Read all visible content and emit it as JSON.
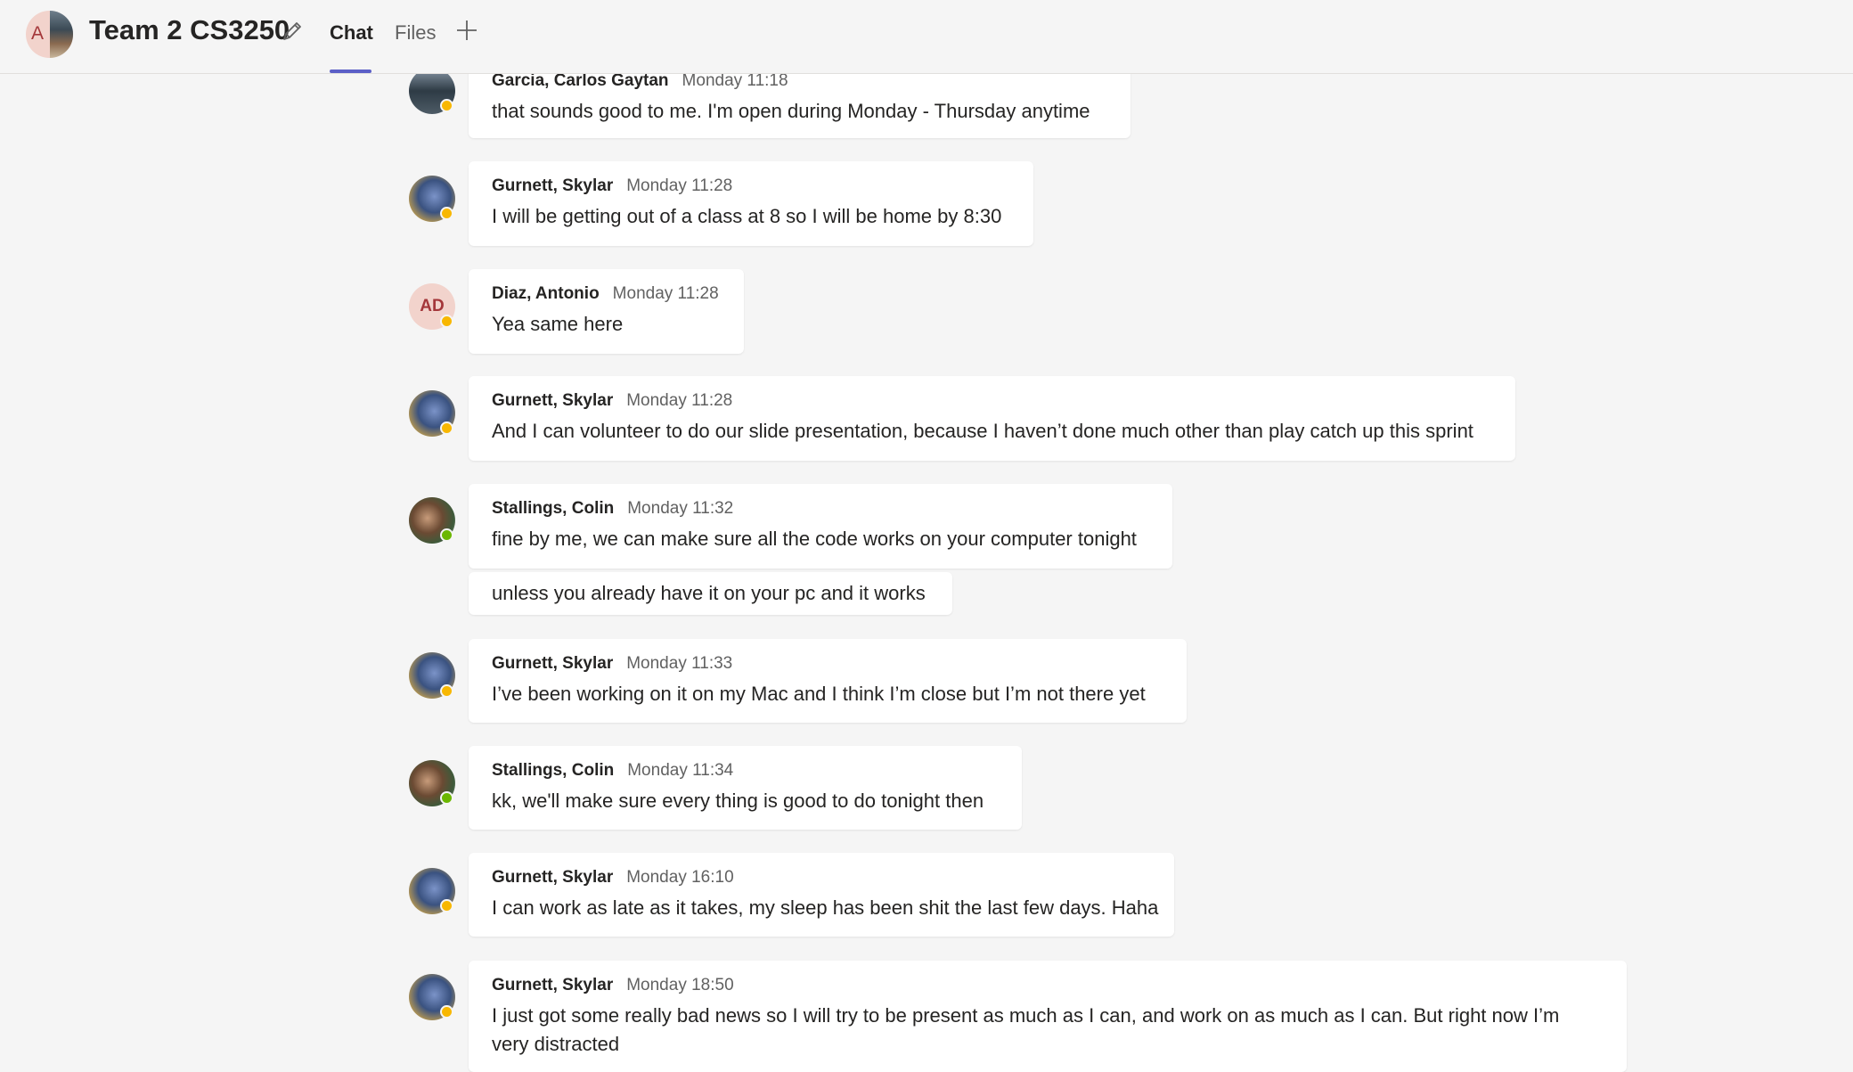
{
  "header": {
    "avatar_initial": "A",
    "title": "Team 2 CS3250",
    "tabs": [
      {
        "label": "Chat"
      },
      {
        "label": "Files"
      }
    ],
    "add_tab_label": "+"
  },
  "messages": [
    {
      "sender": "Garcia, Carlos Gaytan",
      "time": "Monday 11:18",
      "text": "that sounds good to me. I'm open during Monday - Thursday anytime",
      "presence": "away"
    },
    {
      "sender": "Gurnett, Skylar",
      "time": "Monday 11:28",
      "text": "I will be getting out of a class at 8 so I will be home by 8:30",
      "presence": "away"
    },
    {
      "sender": "Diaz, Antonio",
      "initials": "AD",
      "time": "Monday 11:28",
      "text": "Yea same here",
      "presence": "away"
    },
    {
      "sender": "Gurnett, Skylar",
      "time": "Monday 11:28",
      "text": "And I can volunteer to do our slide presentation, because I haven’t done much other than play catch up this sprint",
      "presence": "away"
    },
    {
      "sender": "Stallings, Colin",
      "time": "Monday 11:32",
      "text": "fine by me, we can make sure all the code works on your computer tonight",
      "followup": "unless you already have it on your pc and it works",
      "presence": "available"
    },
    {
      "sender": "Gurnett, Skylar",
      "time": "Monday 11:33",
      "text": "I’ve been working on it on my Mac and I think I’m close but I’m not there yet",
      "presence": "away"
    },
    {
      "sender": "Stallings, Colin",
      "time": "Monday 11:34",
      "text": "kk, we'll make sure every thing is good to do tonight then",
      "presence": "available"
    },
    {
      "sender": "Gurnett, Skylar",
      "time": "Monday 16:10",
      "text": "I can work as late as it takes, my sleep has been shit the last few days. Haha",
      "presence": "away"
    },
    {
      "sender": "Gurnett, Skylar",
      "time": "Monday 18:50",
      "text": "I just got some really bad news so I will try to be present as much as I can, and work on as much as I can. But right now I’m very distracted",
      "presence": "away"
    }
  ],
  "colors": {
    "accent": "#5b5fc7",
    "away": "#f8b700",
    "available": "#6bb700",
    "background": "#f5f5f5"
  }
}
